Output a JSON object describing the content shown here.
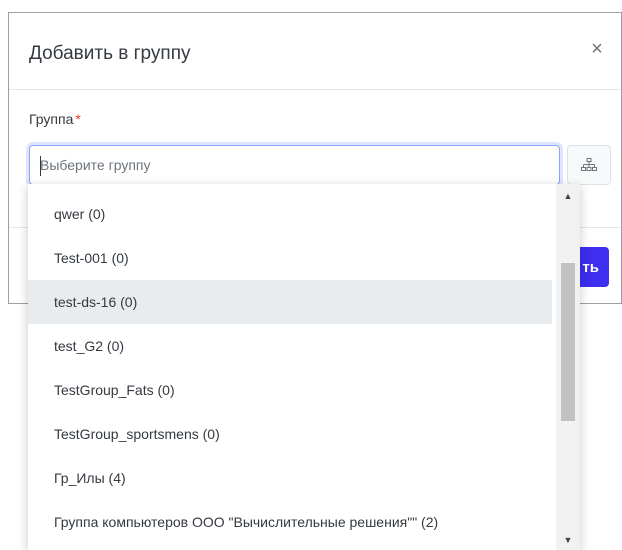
{
  "modal": {
    "title": "Добавить в группу",
    "close_symbol": "×",
    "field_label": "Группа",
    "required_mark": "*",
    "input_placeholder": "Выберите группу",
    "input_value": "",
    "tree_icon": "sitemap-icon",
    "primary_button_visible_text": "ть"
  },
  "dropdown": {
    "items": [
      {
        "label": "qwer (0)",
        "highlighted": false
      },
      {
        "label": "Test-001 (0)",
        "highlighted": false
      },
      {
        "label": "test-ds-16 (0)",
        "highlighted": true
      },
      {
        "label": "test_G2 (0)",
        "highlighted": false
      },
      {
        "label": "TestGroup_Fats (0)",
        "highlighted": false
      },
      {
        "label": "TestGroup_sportsmens (0)",
        "highlighted": false
      },
      {
        "label": "Гр_Илы (4)",
        "highlighted": false
      },
      {
        "label": "Группа компьютеров ООО \"Вычислительные решения\"\" (2)",
        "highlighted": false
      }
    ],
    "scroll_up_symbol": "▲",
    "scroll_down_symbol": "▼"
  },
  "colors": {
    "accent": "#3d2ef0",
    "focus_border": "#8ea3ff",
    "required": "#e53935",
    "highlight_bg": "#e9ecef"
  }
}
